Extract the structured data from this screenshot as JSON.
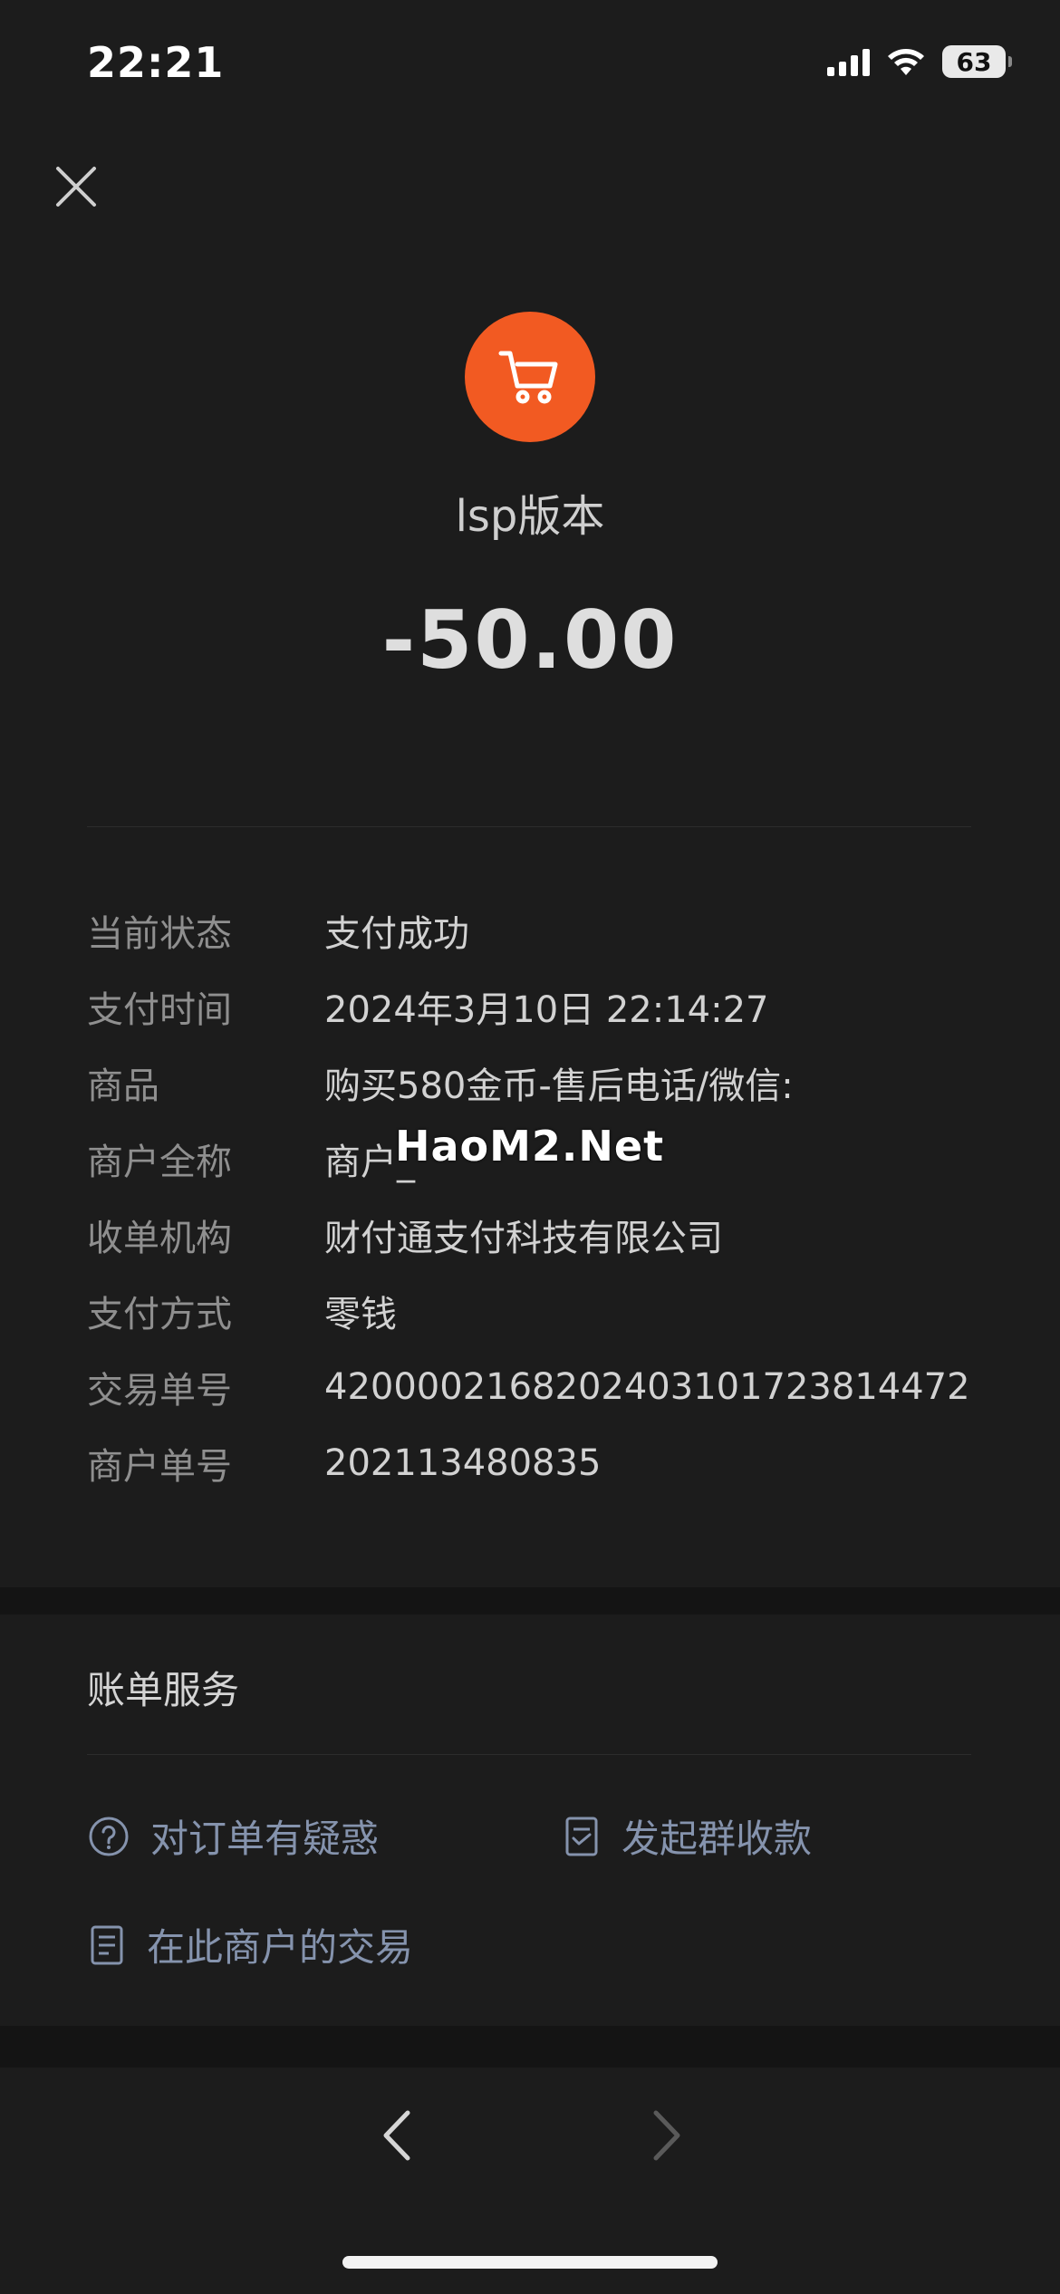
{
  "status_bar": {
    "time": "22:21",
    "battery": "63",
    "icons": [
      "signal-icon",
      "wifi-icon",
      "battery-icon"
    ]
  },
  "header": {
    "close_icon": "close-icon"
  },
  "merchant": {
    "icon": "shopping-cart-icon",
    "icon_color": "#f25a22",
    "name": "lsp版本",
    "amount": "-50.00"
  },
  "details": [
    {
      "label": "当前状态",
      "value": "支付成功"
    },
    {
      "label": "支付时间",
      "value": "2024年3月10日 22:14:27"
    },
    {
      "label": "商品",
      "value": "购买580金币-售后电话/微信:"
    },
    {
      "label": "商户全称",
      "value": "商户_"
    },
    {
      "label": "收单机构",
      "value": "财付通支付科技有限公司"
    },
    {
      "label": "支付方式",
      "value": "零钱"
    },
    {
      "label": "交易单号",
      "value": "4200002168202403101723814472"
    },
    {
      "label": "商户单号",
      "value": "202113480835"
    }
  ],
  "watermark": "HaoM2.Net",
  "services": {
    "title": "账单服务",
    "items": [
      {
        "label": "对订单有疑惑",
        "icon": "question-circle-icon"
      },
      {
        "label": "发起群收款",
        "icon": "document-icon"
      },
      {
        "label": "在此商户的交易",
        "icon": "list-document-icon"
      }
    ]
  },
  "navigation": {
    "back_icon": "chevron-left-icon",
    "forward_icon": "chevron-right-icon"
  },
  "colors": {
    "background": "#1c1c1c",
    "accent_orange": "#f25a22",
    "link_blue_gray": "#8593ad"
  }
}
